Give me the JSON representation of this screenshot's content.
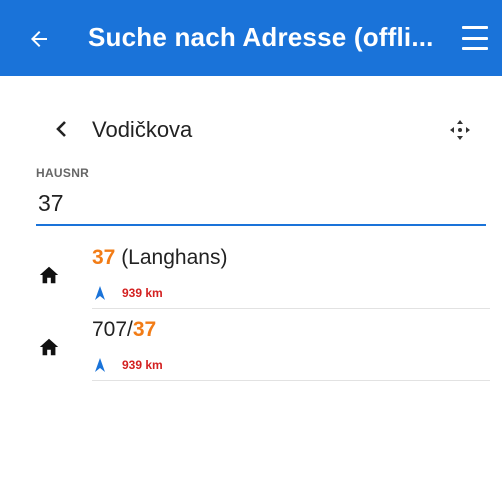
{
  "app_bar": {
    "title": "Suche nach Adresse (offli...",
    "bg_color": "#1a73d9",
    "back_icon": "arrow-left-icon",
    "menu_icon": "hamburger-menu-icon"
  },
  "street": {
    "back_chevron_icon": "chevron-left-icon",
    "name": "Vodičkova",
    "target_icon": "crosshair-target-icon"
  },
  "house_number_field": {
    "label": "HAUSNR",
    "value": "37",
    "underline_color": "#1a73d9"
  },
  "results": [
    {
      "icon": "home-icon",
      "highlight": "37",
      "rest": " (Langhans)",
      "prefix": "",
      "distance_icon": "navigation-arrow-icon",
      "distance": "939 km"
    },
    {
      "icon": "home-icon",
      "prefix": "707/",
      "highlight": "37",
      "rest": "",
      "distance_icon": "navigation-arrow-icon",
      "distance": "939 km"
    }
  ],
  "colors": {
    "highlight": "#f27c16",
    "distance": "#d32020",
    "distance_icon": "#1a73d9"
  }
}
